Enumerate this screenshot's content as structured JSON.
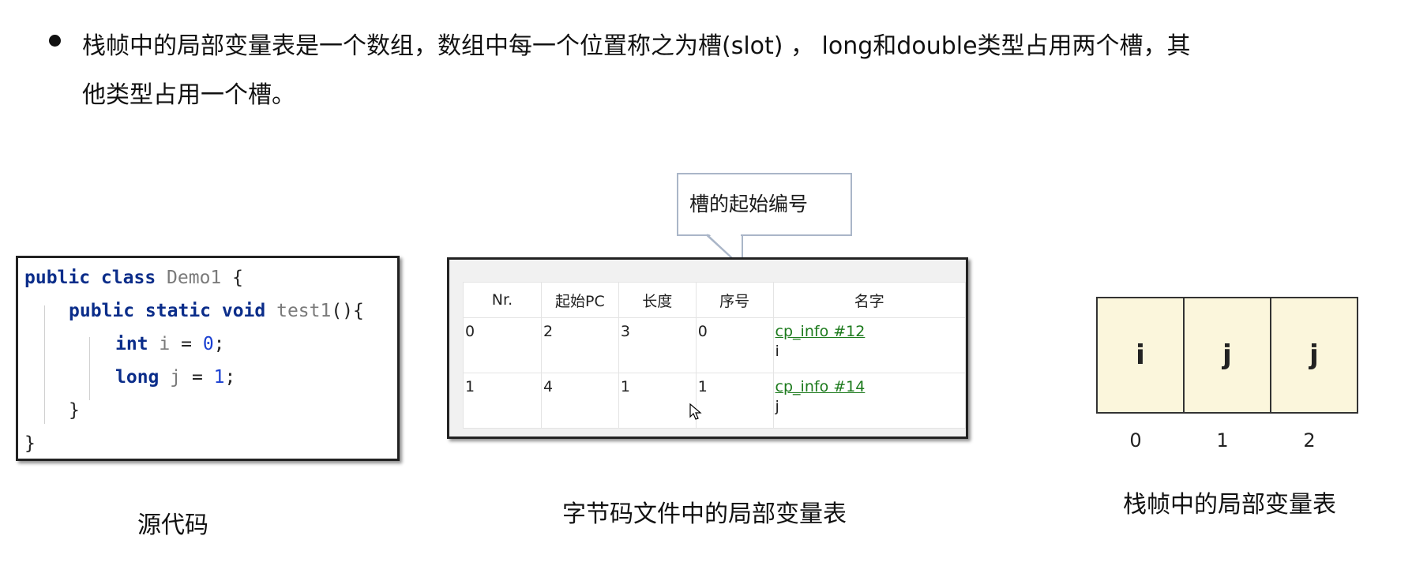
{
  "bullet": {
    "line1": "栈帧中的局部变量表是一个数组，数组中每一个位置称之为槽(slot) ， long和double类型占用两个槽，其",
    "line2": "他类型占用一个槽。"
  },
  "code": {
    "line1": {
      "kw": "public class",
      "name": "Demo1",
      "tail": " {"
    },
    "line2": {
      "kw": "public static void",
      "name": "test1",
      "tail": "(){"
    },
    "line3": {
      "kw": "int",
      "name": "i",
      "op": " = ",
      "value": "0",
      "tail": ";"
    },
    "line4": {
      "kw": "long",
      "name": "j",
      "op": " = ",
      "value": "1",
      "tail": ";"
    },
    "line5": "}",
    "line6": "}"
  },
  "tooltip": {
    "text": "槽的起始编号"
  },
  "bytecode_table": {
    "headers": [
      "Nr.",
      "起始PC",
      "长度",
      "序号",
      "名字"
    ],
    "rows": [
      {
        "nr": "0",
        "start_pc": "2",
        "length": "3",
        "index": "0",
        "name_link": "cp_info #12",
        "name": "i"
      },
      {
        "nr": "1",
        "start_pc": "4",
        "length": "1",
        "index": "1",
        "name_link": "cp_info #14",
        "name": "j"
      }
    ]
  },
  "stack_slots": {
    "values": [
      "i",
      "j",
      "j"
    ],
    "indices": [
      "0",
      "1",
      "2"
    ]
  },
  "captions": {
    "source": "源代码",
    "bytecode": "字节码文件中的局部变量表",
    "stack": "栈帧中的局部变量表"
  },
  "colors": {
    "keyword": "#0b2d8a",
    "number": "#1a3fd1",
    "link": "#1c7a1c",
    "slot_fill": "#fbf6dc",
    "tooltip_border": "#aab6c8"
  }
}
